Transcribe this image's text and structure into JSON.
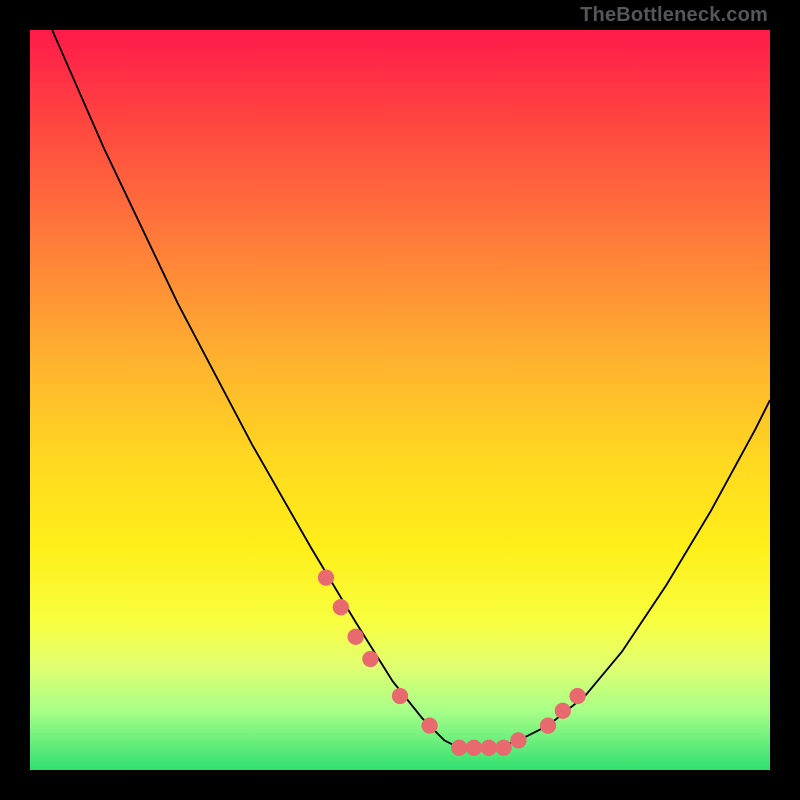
{
  "attribution": "TheBottleneck.com",
  "chart_data": {
    "type": "line",
    "title": "",
    "xlabel": "",
    "ylabel": "",
    "xlim": [
      0,
      100
    ],
    "ylim": [
      0,
      100
    ],
    "series": [
      {
        "name": "curve",
        "x": [
          3,
          10,
          20,
          30,
          38,
          44,
          49,
          53,
          56,
          58,
          60,
          63,
          66,
          70,
          75,
          80,
          86,
          92,
          98,
          100
        ],
        "y": [
          100,
          84,
          63,
          44,
          30,
          20,
          12,
          7,
          4,
          3,
          3,
          3,
          4,
          6,
          10,
          16,
          25,
          35,
          46,
          50
        ]
      },
      {
        "name": "markers",
        "x": [
          40,
          42,
          44,
          46,
          50,
          54,
          58,
          60,
          62,
          64,
          66,
          70,
          72,
          74
        ],
        "y": [
          26,
          22,
          18,
          15,
          10,
          6,
          3,
          3,
          3,
          3,
          4,
          6,
          8,
          10
        ]
      }
    ],
    "marker_color": "#e86a6e",
    "line_color": "#000000"
  }
}
